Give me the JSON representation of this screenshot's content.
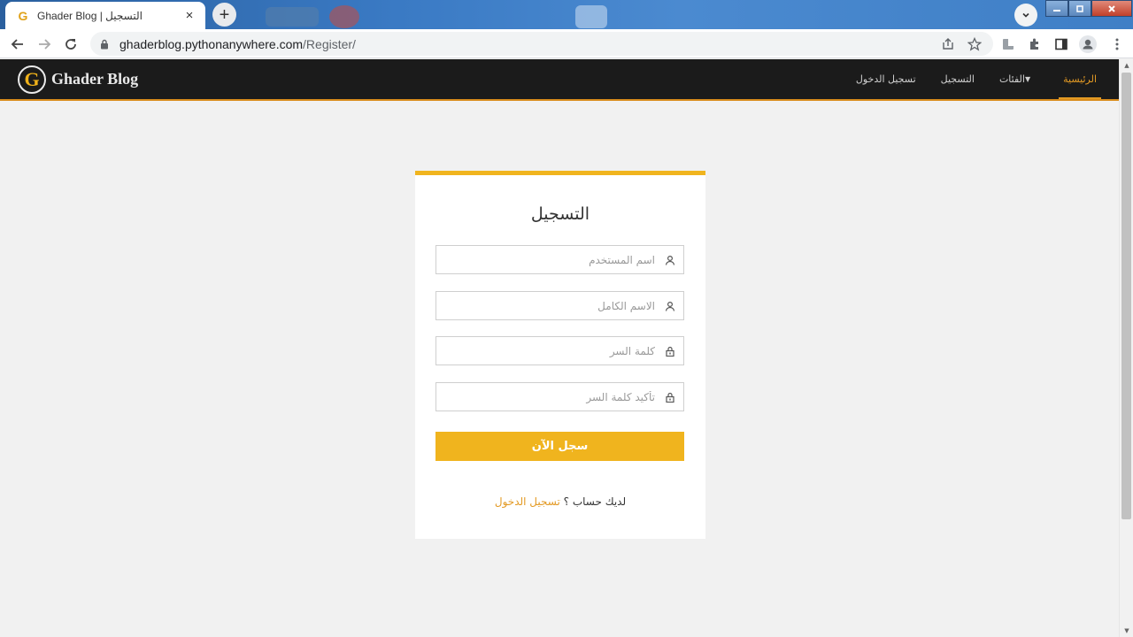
{
  "browser": {
    "tab_title": "Ghader Blog | التسجيل",
    "tab_favicon": "G",
    "tab_close": "×",
    "new_tab": "+",
    "url_host": "ghaderblog.pythonanywhere.com",
    "url_path": "/Register/",
    "icons": [
      "back-icon",
      "forward-icon",
      "reload-icon",
      "lock-icon",
      "share-icon",
      "star-icon",
      "reading-list-icon",
      "extensions-icon",
      "side-panel-icon",
      "profile-icon",
      "menu-icon"
    ]
  },
  "site": {
    "logo_letter": "G",
    "brand": "Ghader Blog",
    "accent": "#f0b41e",
    "nav": {
      "home": "الرئيسية",
      "categories": "الفئات",
      "register": "التسجيل",
      "login": "تسجيل الدخول"
    }
  },
  "form": {
    "title": "التسجيل",
    "username_placeholder": "اسم المستخدم",
    "fullname_placeholder": "الاسم الكامل",
    "password_placeholder": "كلمة السر",
    "confirm_placeholder": "تأكيد كلمة السر",
    "submit_label": "سجل الآن",
    "have_account": "لديك حساب ؟",
    "login_link": "تسجيل الدخول"
  }
}
